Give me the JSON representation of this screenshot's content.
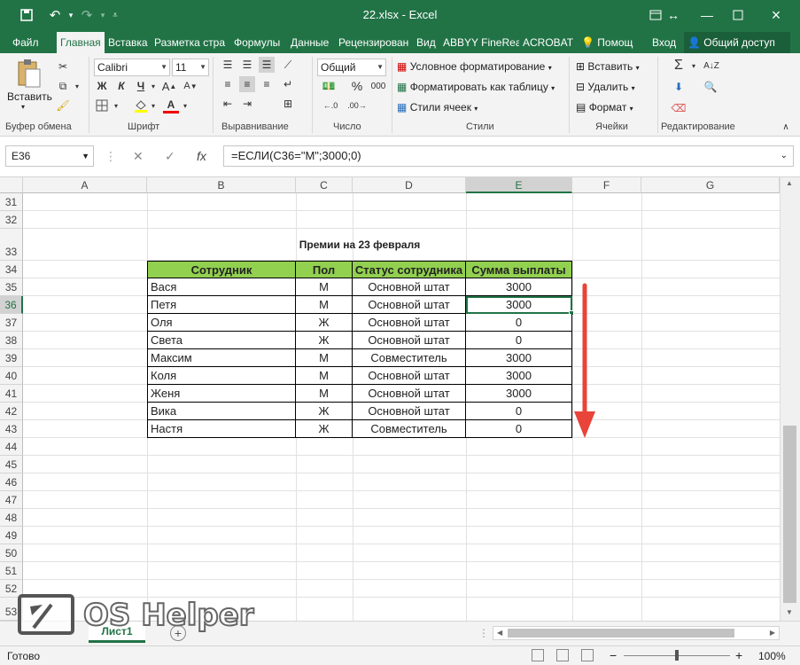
{
  "titlebar": {
    "title": "22.xlsx - Excel",
    "save_icon": "save-icon",
    "undo_icon": "undo-icon",
    "redo_icon": "redo-icon"
  },
  "tabs": [
    "Файл",
    "Главная",
    "Вставка",
    "Разметка стра",
    "Формулы",
    "Данные",
    "Рецензирован",
    "Вид",
    "ABBYY FineRea",
    "ACROBAT",
    "Помощ",
    "Вход",
    "Общий доступ"
  ],
  "ribbon": {
    "clipboard": {
      "paste_label": "Вставить",
      "group_label": "Буфер обмена"
    },
    "font": {
      "font_name": "Calibri",
      "font_size": "11",
      "bold": "Ж",
      "italic": "К",
      "underline": "Ч",
      "group_label": "Шрифт"
    },
    "alignment": {
      "group_label": "Выравнивание"
    },
    "number": {
      "format": "Общий",
      "percent": "%",
      "thousands": "000",
      "group_label": "Число"
    },
    "styles": {
      "conditional": "Условное форматирование",
      "as_table": "Форматировать как таблицу",
      "cell_styles": "Стили ячеек",
      "group_label": "Стили"
    },
    "cells": {
      "insert": "Вставить",
      "delete": "Удалить",
      "format": "Формат",
      "group_label": "Ячейки"
    },
    "editing": {
      "group_label": "Редактирование"
    }
  },
  "formula_bar": {
    "name_box": "E36",
    "fx": "fx",
    "formula": "=ЕСЛИ(C36=\"М\";3000;0)"
  },
  "columns": [
    "A",
    "B",
    "C",
    "D",
    "E",
    "F",
    "G"
  ],
  "rows": [
    "31",
    "32",
    "33",
    "34",
    "35",
    "36",
    "37",
    "38",
    "39",
    "40",
    "41",
    "42",
    "43",
    "44",
    "45",
    "46",
    "47",
    "48",
    "49",
    "50",
    "51",
    "52",
    "53"
  ],
  "sheet": {
    "title": "Премии на 23 февраля",
    "headers": [
      "Сотрудник",
      "Пол",
      "Статус сотрудника",
      "Сумма выплаты"
    ],
    "data": [
      [
        "Вася",
        "М",
        "Основной штат",
        "3000"
      ],
      [
        "Петя",
        "М",
        "Основной штат",
        "3000"
      ],
      [
        "Оля",
        "Ж",
        "Основной штат",
        "0"
      ],
      [
        "Света",
        "Ж",
        "Основной штат",
        "0"
      ],
      [
        "Максим",
        "М",
        "Совместитель",
        "3000"
      ],
      [
        "Коля",
        "М",
        "Основной штат",
        "3000"
      ],
      [
        "Женя",
        "М",
        "Основной штат",
        "3000"
      ],
      [
        "Вика",
        "Ж",
        "Основной штат",
        "0"
      ],
      [
        "Настя",
        "Ж",
        "Совместитель",
        "0"
      ]
    ]
  },
  "sheet_tab": "Лист1",
  "status": {
    "ready": "Готово",
    "zoom": "100%"
  },
  "watermark": "OS Helper",
  "colors": {
    "accent": "#217346",
    "header_fill": "#92d050",
    "arrow": "#e8443a"
  }
}
